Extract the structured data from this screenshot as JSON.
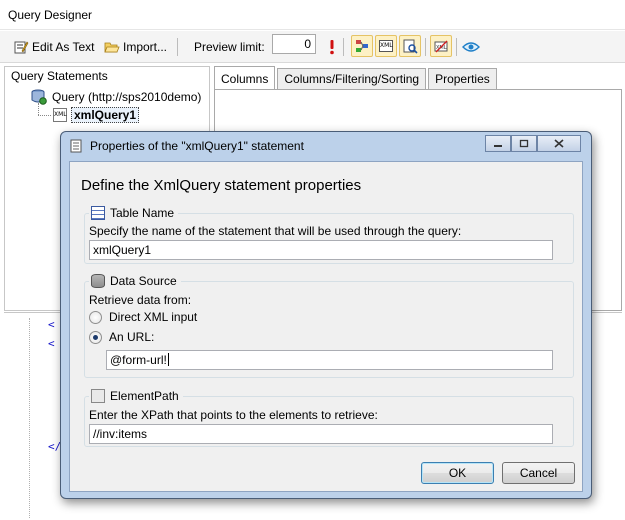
{
  "window": {
    "title": "Query Designer"
  },
  "toolbar": {
    "edit_as_text": "Edit As Text",
    "import": "Import...",
    "preview_limit_label": "Preview limit:",
    "preview_limit_value": "0",
    "tool_icons": [
      "run-icon",
      "schema-icon",
      "xml-icon",
      "find-icon",
      "xml-edit-icon",
      "eye-icon"
    ]
  },
  "left_pane": {
    "header": "Query Statements",
    "root_label": "Query (http://sps2010demo)",
    "child_label": "xmlQuery1",
    "child_icon_text": "XML"
  },
  "tabs": [
    "Columns",
    "Columns/Filtering/Sorting",
    "Properties"
  ],
  "code": {
    "frag1": "<",
    "frag2": "<",
    "frag3": "</"
  },
  "dialog": {
    "title": "Properties of the \"xmlQuery1\" statement",
    "heading": "Define the XmlQuery statement properties",
    "table_name": {
      "legend": "Table Name",
      "description": "Specify the name of the statement that will be used through the query:",
      "value": "xmlQuery1"
    },
    "data_source": {
      "legend": "Data Source",
      "retrieve_label": "Retrieve data from:",
      "option_direct": "Direct XML input",
      "option_url": "An URL:",
      "selected": "An URL:",
      "url_value": "@form-url!"
    },
    "element_path": {
      "legend": "ElementPath",
      "description": "Enter the XPath that points to the elements to retrieve:",
      "value": "//inv:items"
    },
    "ok_label": "OK",
    "cancel_label": "Cancel"
  },
  "colors": {
    "dialog_frame": "#bcd1ea",
    "dialog_client": "#f0f0f0",
    "selection": "#fdf1c5"
  }
}
